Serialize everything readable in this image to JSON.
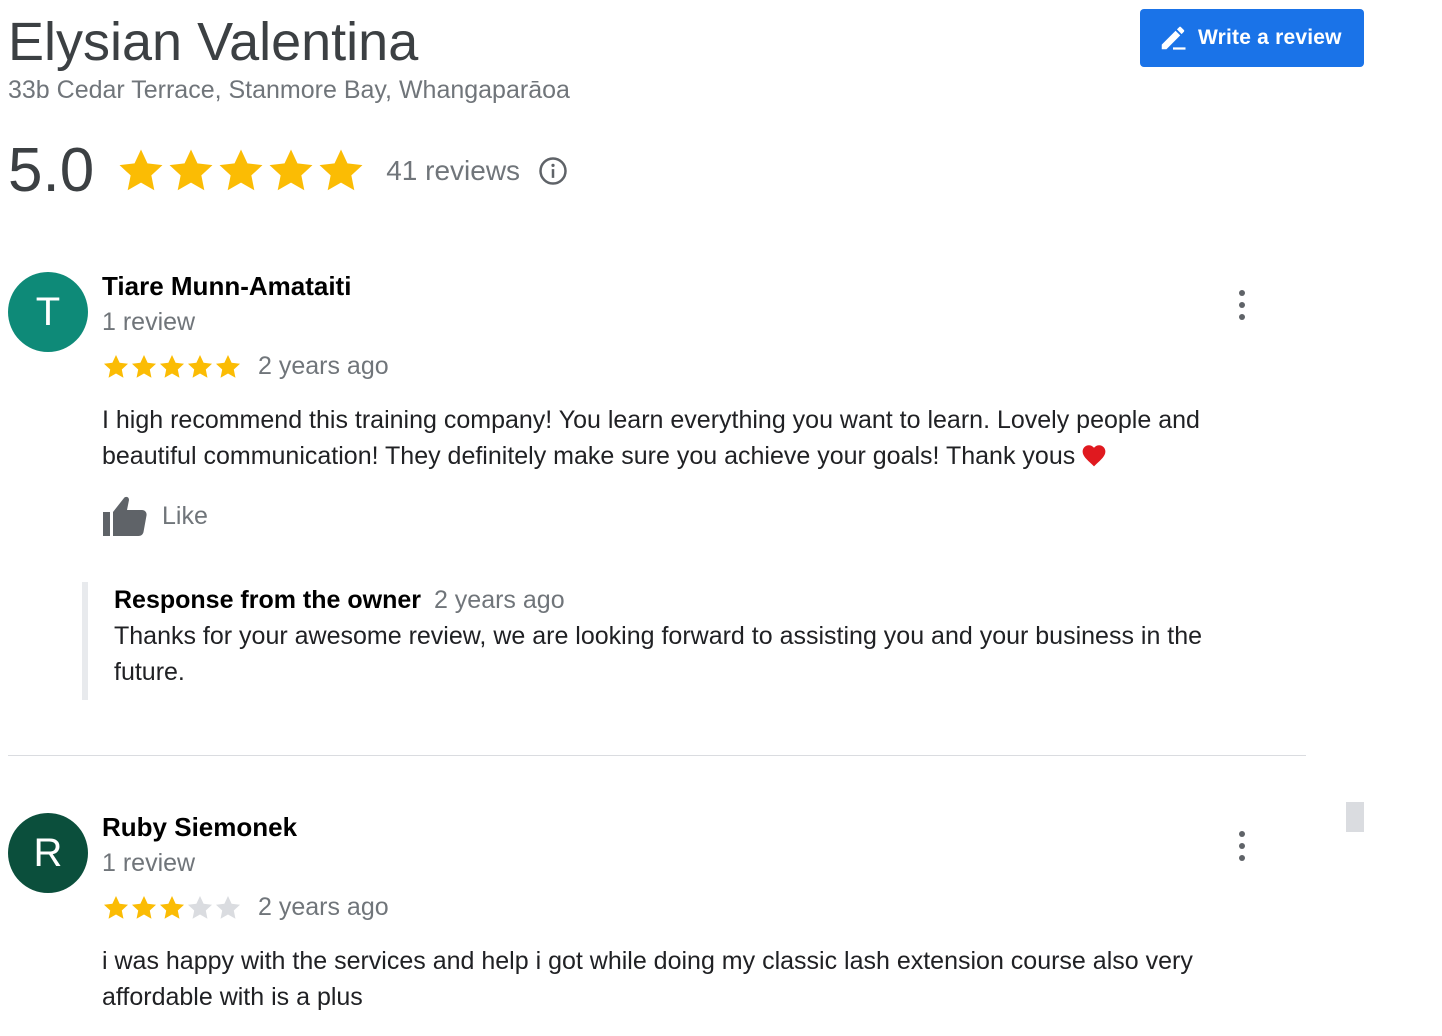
{
  "business": {
    "name": "Elysian Valentina",
    "address": "33b Cedar Terrace, Stanmore Bay, Whangaparāoa"
  },
  "write_review": {
    "label": "Write a review",
    "icon": "pencil-icon"
  },
  "summary": {
    "rating": "5.0",
    "stars": 5,
    "review_count": "41 reviews",
    "info_icon": "info-icon"
  },
  "colors": {
    "accent": "#1a73e8",
    "star": "#fbbc04",
    "star_empty": "#dadce0",
    "muted_text": "#70757a"
  },
  "reviews": [
    {
      "avatar_letter": "T",
      "avatar_color": "#0e8a78",
      "name": "Tiare Munn-Amataiti",
      "review_count": "1 review",
      "stars": 5,
      "date": "2 years ago",
      "text": "I high recommend this training company! You learn everything you want to learn. Lovely people and beautiful communication! They definitely make sure you achieve your goals! Thank yous",
      "emoji": "heart-icon",
      "like_label": "Like",
      "owner_response": {
        "label": "Response from the owner",
        "date": "2 years ago",
        "text": "Thanks for your awesome review, we are looking forward to assisting you and your business in the future."
      }
    },
    {
      "avatar_letter": "R",
      "avatar_color": "#0b4f3c",
      "name": "Ruby Siemonek",
      "review_count": "1 review",
      "stars": 3,
      "date": "2 years ago",
      "text": "i was happy with the services and help i got while doing my classic lash extension course also very affordable with is a plus"
    }
  ]
}
